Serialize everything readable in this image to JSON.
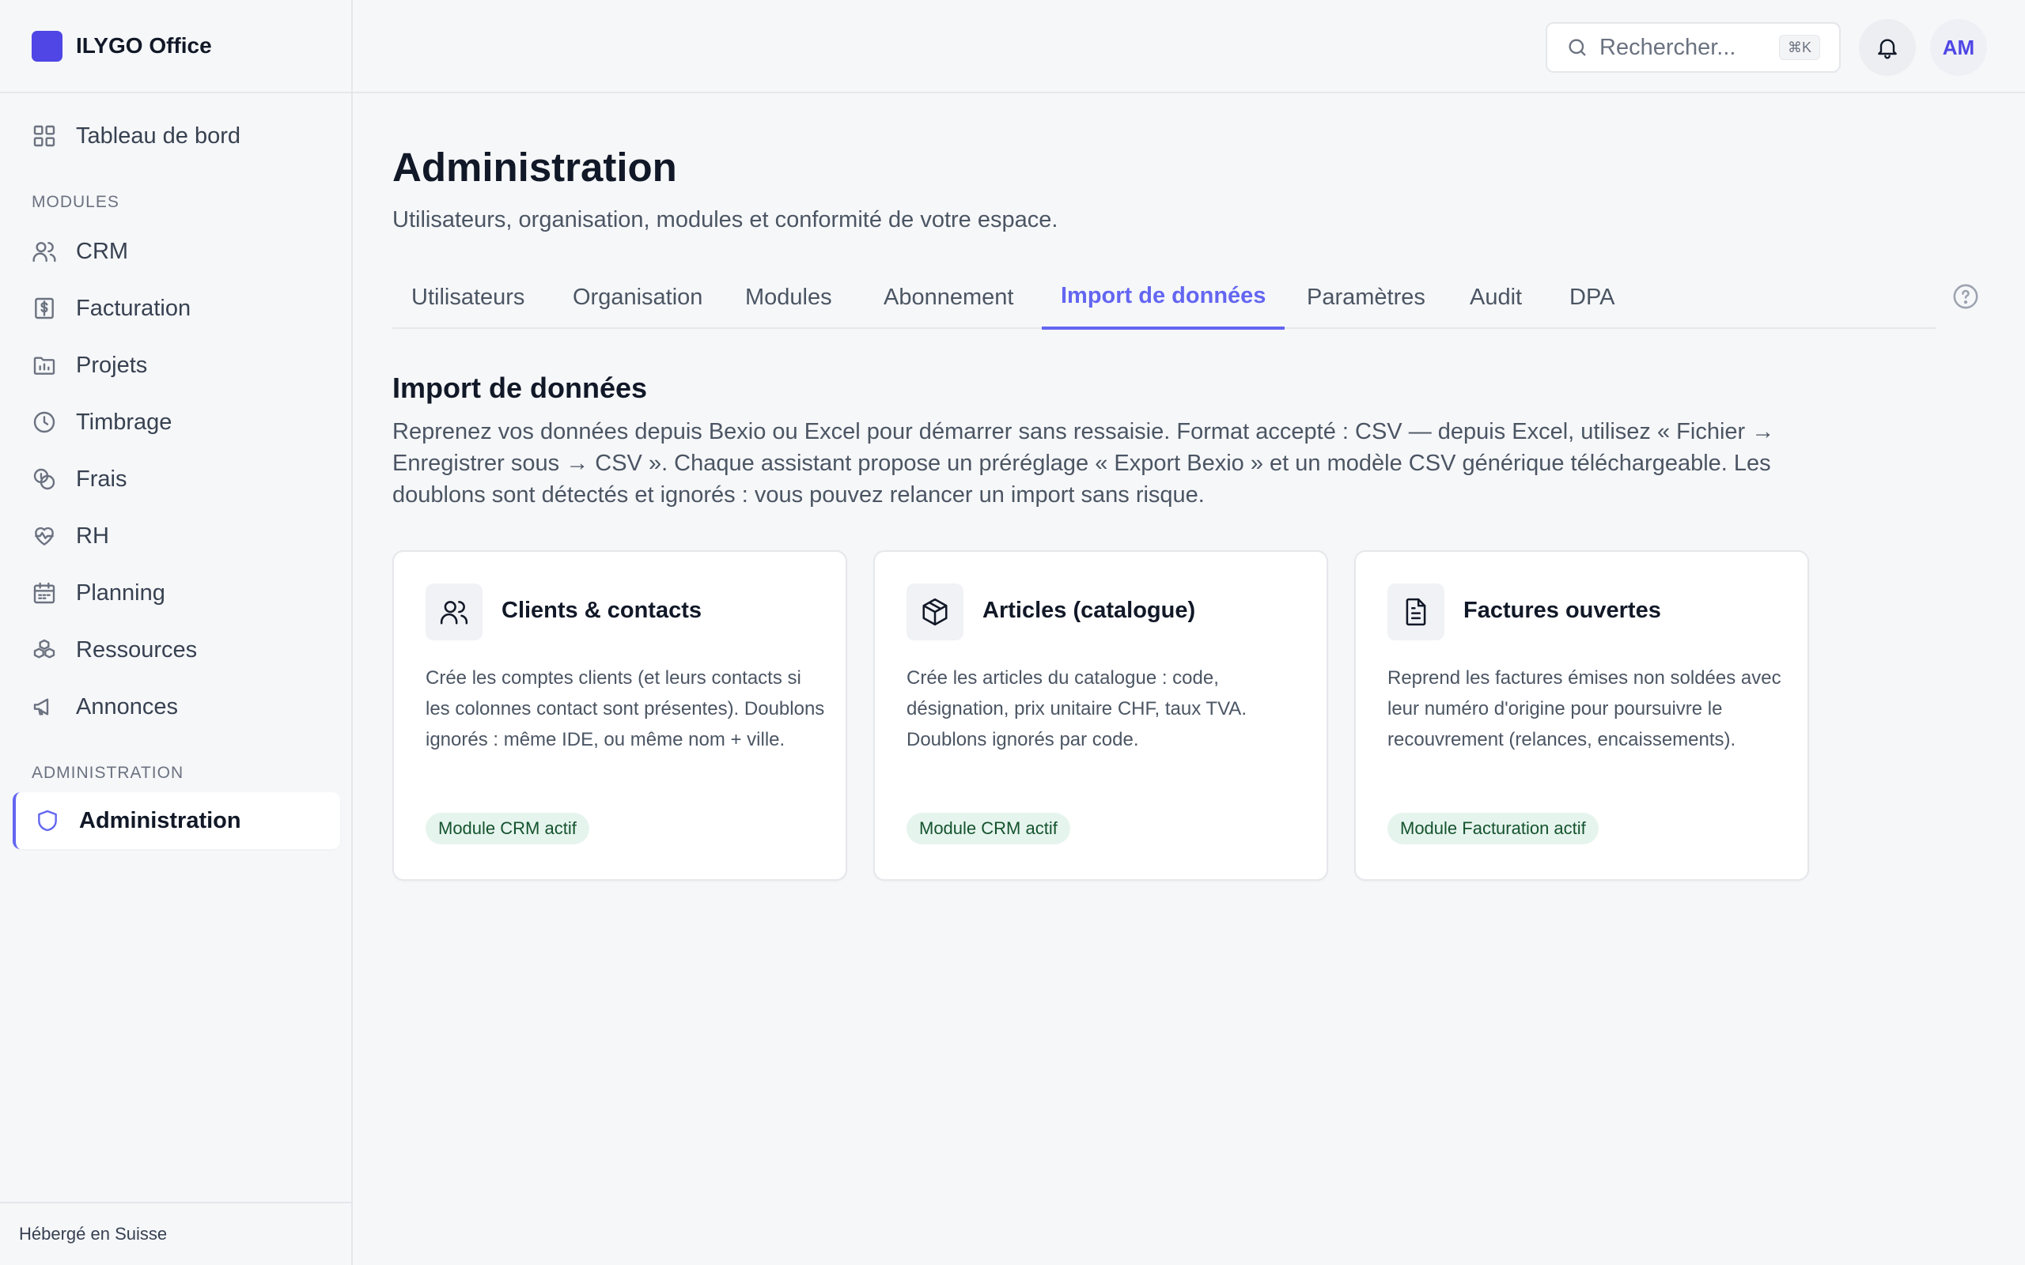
{
  "app": {
    "name": "ILYGO Office",
    "brand_color": "#4f46e5",
    "accent_color": "#6366f1"
  },
  "sidebar": {
    "dashboard": {
      "label": "Tableau de bord",
      "icon": "grid-icon"
    },
    "modules_heading": "MODULES",
    "modules": [
      {
        "label": "CRM",
        "icon": "users-icon"
      },
      {
        "label": "Facturation",
        "icon": "dollar-receipt-icon"
      },
      {
        "label": "Projets",
        "icon": "folder-chart-icon"
      },
      {
        "label": "Timbrage",
        "icon": "clock-icon"
      },
      {
        "label": "Frais",
        "icon": "coins-icon"
      },
      {
        "label": "RH",
        "icon": "heart-pulse-icon"
      },
      {
        "label": "Planning",
        "icon": "calendar-icon"
      },
      {
        "label": "Ressources",
        "icon": "boxes-icon"
      },
      {
        "label": "Annonces",
        "icon": "megaphone-icon"
      }
    ],
    "admin_heading": "ADMINISTRATION",
    "admin": {
      "label": "Administration",
      "icon": "shield-icon",
      "active": true
    },
    "footer": "Hébergé en Suisse"
  },
  "topbar": {
    "search_placeholder": "Rechercher...",
    "search_shortcut": "⌘K",
    "user_initials": "AM"
  },
  "page": {
    "title": "Administration",
    "subtitle": "Utilisateurs, organisation, modules et conformité de votre espace."
  },
  "tabs": [
    {
      "label": "Utilisateurs"
    },
    {
      "label": "Organisation"
    },
    {
      "label": "Modules"
    },
    {
      "label": "Abonnement"
    },
    {
      "label": "Import de données",
      "active": true
    },
    {
      "label": "Paramètres"
    },
    {
      "label": "Audit"
    },
    {
      "label": "DPA"
    }
  ],
  "import": {
    "title": "Import de données",
    "description": "Reprenez vos données depuis Bexio ou Excel pour démarrer sans ressaisie. Format accepté : CSV — depuis Excel, utilisez « Fichier → Enregistrer sous → CSV ». Chaque assistant propose un préréglage « Export Bexio » et un modèle CSV générique téléchargeable. Les doublons sont détectés et ignorés : vous pouvez relancer un import sans risque.",
    "cards": [
      {
        "title": "Clients & contacts",
        "icon": "users-icon",
        "description": "Crée les comptes clients (et leurs contacts si les colonnes contact sont présentes). Doublons ignorés : même IDE, ou même nom + ville.",
        "badge": "Module CRM actif"
      },
      {
        "title": "Articles (catalogue)",
        "icon": "package-icon",
        "description": "Crée les articles du catalogue : code, désignation, prix unitaire CHF, taux TVA. Doublons ignorés par code.",
        "badge": "Module CRM actif"
      },
      {
        "title": "Factures ouvertes",
        "icon": "file-text-icon",
        "description": "Reprend les factures émises non soldées avec leur numéro d'origine pour poursuivre le recouvrement (relances, encaissements).",
        "badge": "Module Facturation actif"
      }
    ]
  }
}
